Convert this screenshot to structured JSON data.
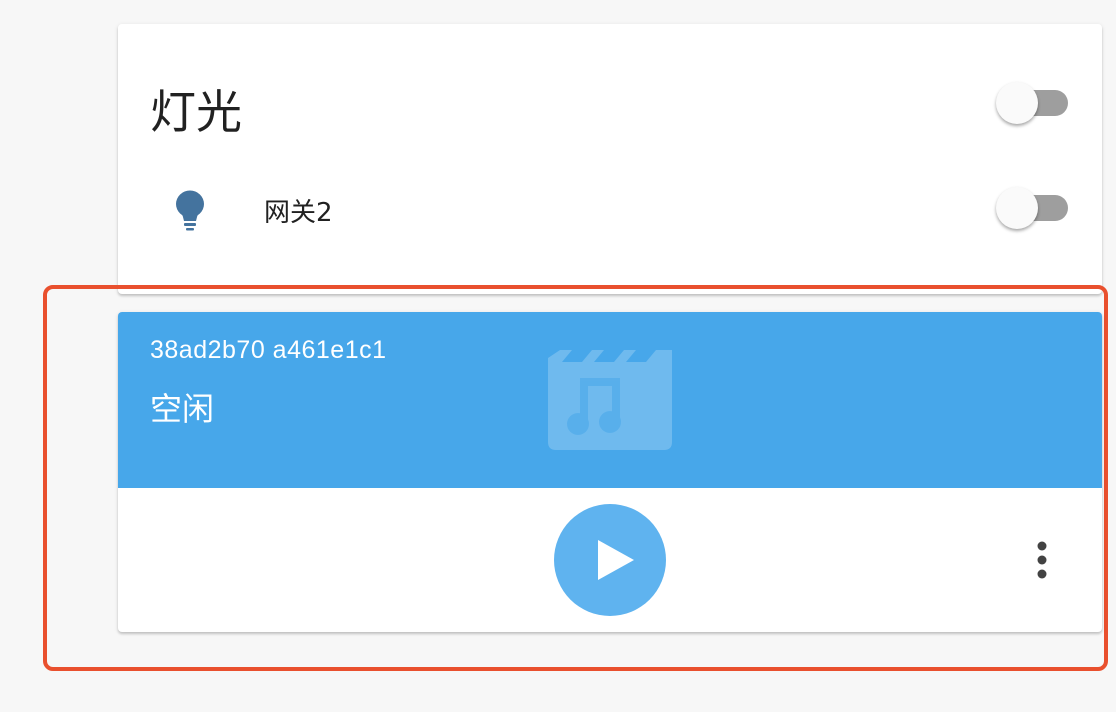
{
  "lights_card": {
    "title": "灯光",
    "group_toggle_on": false,
    "entities": [
      {
        "name": "网关2",
        "icon": "lightbulb-icon",
        "icon_color": "#44739e",
        "on": false
      }
    ]
  },
  "media_card": {
    "entity_id": "38ad2b70 a461e1c1",
    "state": "空闲",
    "banner_color": "#47a7ea",
    "art_icon": "movie-music-icon",
    "play_icon": "play-icon",
    "menu_icon": "more-vertical-icon"
  },
  "highlight_color": "#e9502e"
}
